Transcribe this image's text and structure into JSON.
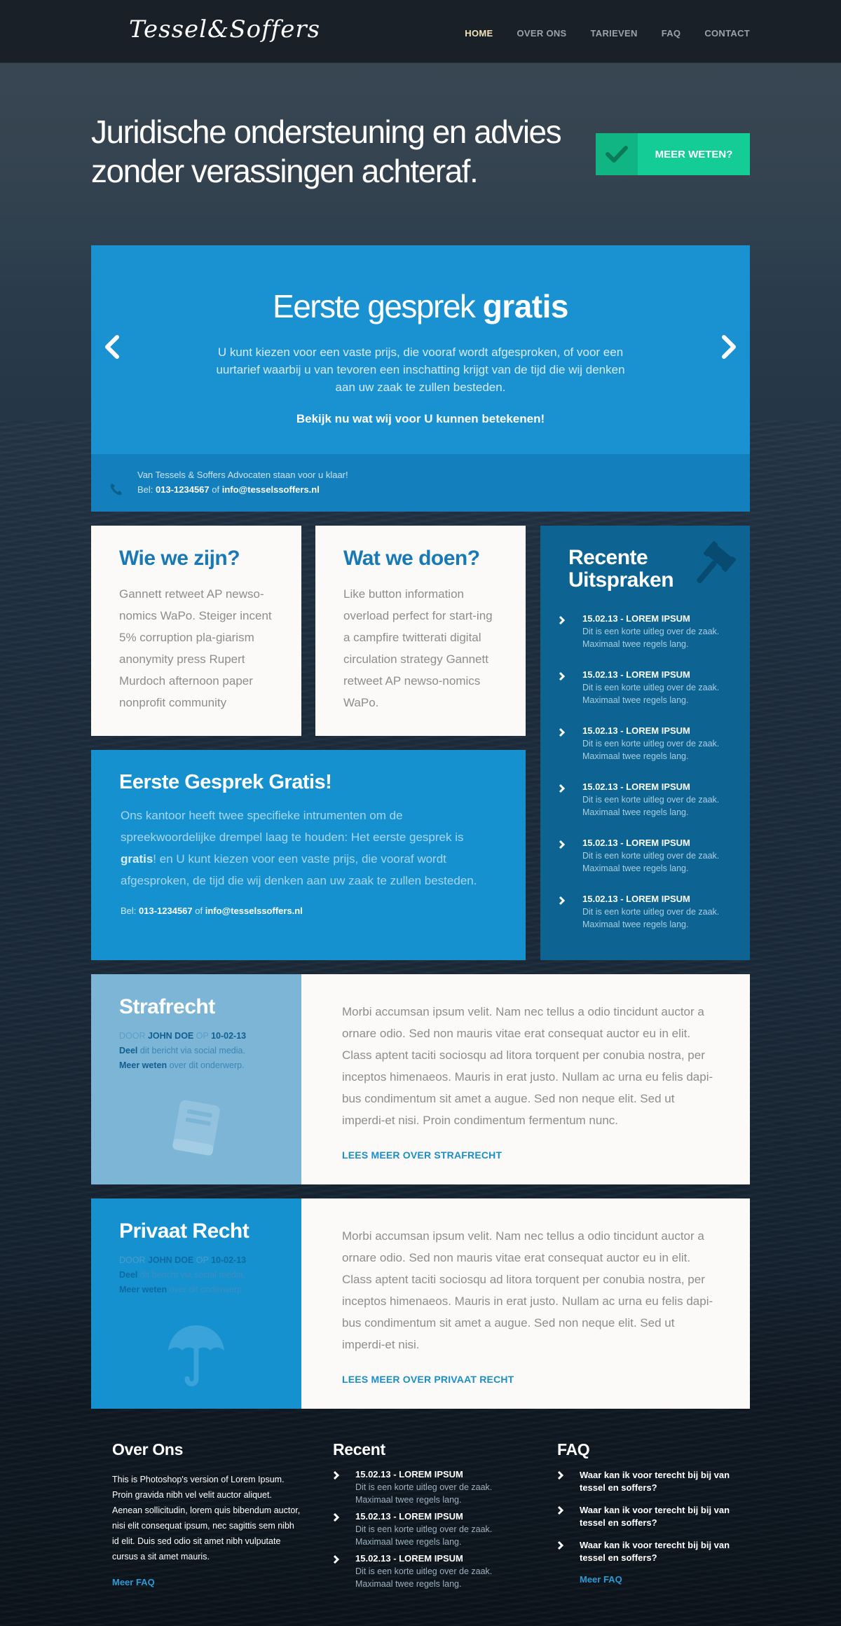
{
  "header": {
    "logo": "Tessel&Soffers",
    "nav": [
      {
        "label": "HOME",
        "active": true
      },
      {
        "label": "OVER ONS"
      },
      {
        "label": "TARIEVEN"
      },
      {
        "label": "FAQ"
      },
      {
        "label": "CONTACT"
      }
    ]
  },
  "hero": {
    "title_line1": "Juridische ondersteuning en advies",
    "title_line2": "zonder verassingen achteraf.",
    "cta_label": "MEER WETEN?",
    "cta_icon": "check-icon",
    "cta_color": "#14cc95"
  },
  "slider": {
    "title_light": "Eerste gesprek ",
    "title_bold": "gratis",
    "text": "U kunt kiezen voor een vaste prijs, die vooraf wordt afgesproken, of voor een uurtarief waarbij u van tevoren een inschatting krijgt van de tijd die wij denken aan uw zaak te zullen besteden.",
    "cta": "Bekijk nu wat wij voor U kunnen betekenen!",
    "footer_line1": "Van Tessels & Soffers Advocaten staan voor u klaar!",
    "phone_prefix": "Bel: ",
    "phone": "013-1234567",
    "or": " of ",
    "email": "info@tesselssoffers.nl",
    "accent": "#1a92d2"
  },
  "about": {
    "title": "Wie we zijn?",
    "text": "Gannett retweet AP newso-nomics WaPo. Steiger incent 5% corruption pla-giarism anonymity press Rupert Murdoch afternoon paper nonprofit community"
  },
  "work": {
    "title": "Wat we doen?",
    "text": "Like button information overload perfect for start-ing a campfire twitterati digital circulation strategy Gannett retweet AP newso-nomics WaPo."
  },
  "recent": {
    "title": "Recente Uitspraken",
    "icon": "gavel-icon",
    "items": [
      {
        "title": "15.02.13 - LOREM IPSUM",
        "desc": "Dit is een korte uitleg over de zaak. Maximaal twee regels lang."
      },
      {
        "title": "15.02.13 - LOREM IPSUM",
        "desc": "Dit is een korte uitleg over de zaak. Maximaal twee regels lang."
      },
      {
        "title": "15.02.13 - LOREM IPSUM",
        "desc": "Dit is een korte uitleg over de zaak. Maximaal twee regels lang."
      },
      {
        "title": "15.02.13 - LOREM IPSUM",
        "desc": "Dit is een korte uitleg over de zaak. Maximaal twee regels lang."
      },
      {
        "title": "15.02.13 - LOREM IPSUM",
        "desc": "Dit is een korte uitleg over de zaak. Maximaal twee regels lang."
      },
      {
        "title": "15.02.13 - LOREM IPSUM",
        "desc": "Dit is een korte uitleg over de zaak. Maximaal twee regels lang."
      }
    ]
  },
  "free": {
    "title": "Eerste Gesprek Gratis!",
    "text_before": "Ons kantoor heeft twee specifieke intrumenten om de spreekwoordelijke drempel laag te houden: Het eerste gesprek is ",
    "text_bold": "gratis",
    "text_after": "! en U kunt kiezen voor een vaste prijs, die vooraf wordt afgesproken, de tijd die wij denken aan uw zaak te zullen besteden.",
    "phone_prefix": "Bel: ",
    "phone": "013-1234567",
    "or": " of ",
    "email": "info@tesselssoffers.nl"
  },
  "articles": [
    {
      "title": "Strafrecht",
      "by": "DOOR ",
      "author": "JOHN DOE",
      "on": " OP ",
      "date": "10-02-13",
      "share_bold": "Deel",
      "share_rest": " dit bericht via social media.",
      "more_bold": "Meer weten",
      "more_rest": " over dit onderwerp.",
      "icon": "book-icon",
      "text": "Morbi accumsan ipsum velit. Nam nec tellus a odio tincidunt auctor a ornare odio. Sed non  mauris vitae erat consequat auctor eu in elit. Class aptent taciti sociosqu ad litora torquent per conubia nostra, per inceptos himenaeos. Mauris in erat justo. Nullam ac urna eu felis dapi-bus condimentum sit amet a augue. Sed non neque elit. Sed ut imperdi-et nisi. Proin condimentum fermentum nunc.",
      "link": "LEES MEER OVER STRAFRECHT"
    },
    {
      "title": "Privaat Recht",
      "by": "DOOR ",
      "author": "JOHN DOE",
      "on": " OP ",
      "date": "10-02-13",
      "share_bold": "Deel",
      "share_rest": " dit bericht via social media.",
      "more_bold": "Meer weten",
      "more_rest": " over dit onderwerp.",
      "icon": "umbrella-icon",
      "text": "Morbi accumsan ipsum velit. Nam nec tellus a odio tincidunt auctor a ornare odio. Sed non  mauris vitae erat consequat auctor eu in elit. Class aptent taciti sociosqu ad litora torquent per conubia nostra, per inceptos himenaeos. Mauris in erat justo. Nullam ac urna eu felis dapi-bus condimentum sit amet a augue. Sed non neque elit. Sed ut imperdi-et nisi.",
      "link": "LEES MEER OVER PRIVAAT RECHT"
    }
  ],
  "footer": {
    "about": {
      "title": "Over Ons",
      "text": "This is Photoshop's version  of Lorem Ipsum. Proin gravida nibh vel velit auctor aliquet. Aenean sollicitudin, lorem quis bibendum auctor, nisi elit consequat ipsum, nec sagittis sem nibh id elit. Duis sed odio sit amet nibh vulputate cursus a sit amet mauris.",
      "link": "Meer FAQ"
    },
    "recent": {
      "title": "Recent",
      "items": [
        {
          "title": "15.02.13 - LOREM IPSUM",
          "desc": "Dit is een korte uitleg over de zaak. Maximaal twee regels lang."
        },
        {
          "title": "15.02.13 - LOREM IPSUM",
          "desc": "Dit is een korte uitleg over de zaak. Maximaal twee regels lang."
        },
        {
          "title": "15.02.13 - LOREM IPSUM",
          "desc": "Dit is een korte uitleg over de zaak. Maximaal twee regels lang."
        }
      ]
    },
    "faq": {
      "title": "FAQ",
      "items": [
        {
          "q": "Waar kan ik voor terecht bij bij van tessel en soffers?"
        },
        {
          "q": "Waar kan ik voor terecht bij bij van tessel en soffers?"
        },
        {
          "q": "Waar kan ik voor terecht bij bij van tessel en soffers?"
        }
      ],
      "link": "Meer FAQ"
    }
  }
}
